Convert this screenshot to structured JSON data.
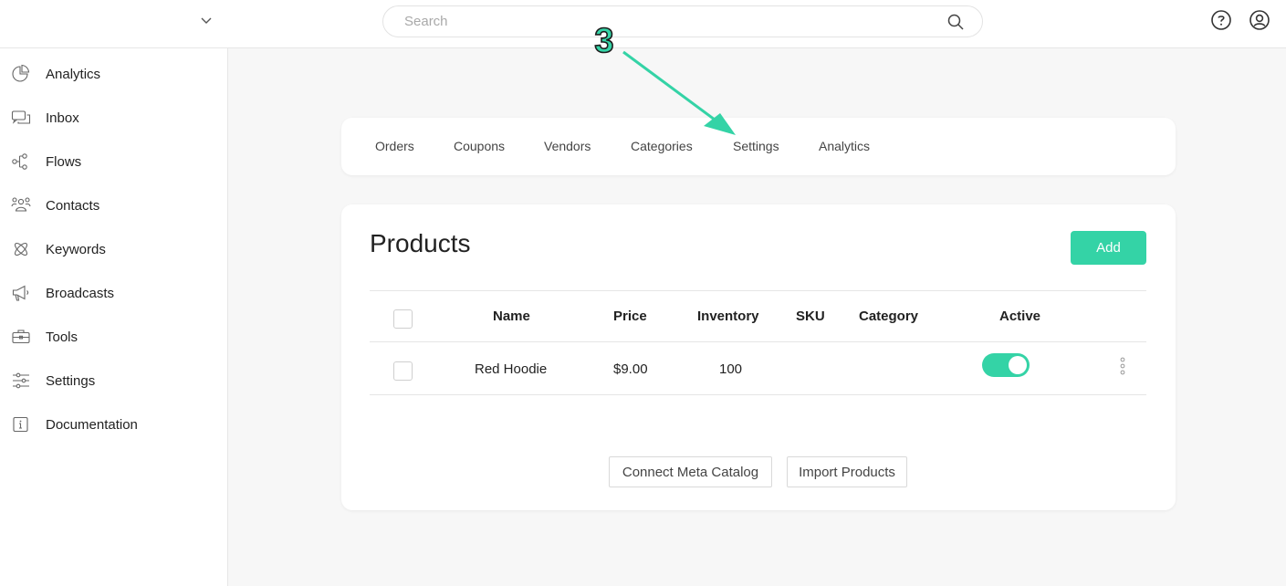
{
  "topbar": {
    "search_placeholder": "Search"
  },
  "sidebar": {
    "items": [
      {
        "label": "Analytics",
        "icon": "analytics-icon"
      },
      {
        "label": "Inbox",
        "icon": "inbox-icon"
      },
      {
        "label": "Flows",
        "icon": "flows-icon"
      },
      {
        "label": "Contacts",
        "icon": "contacts-icon"
      },
      {
        "label": "Keywords",
        "icon": "keywords-icon"
      },
      {
        "label": "Broadcasts",
        "icon": "broadcasts-icon"
      },
      {
        "label": "Tools",
        "icon": "tools-icon"
      },
      {
        "label": "Settings",
        "icon": "settings-icon"
      },
      {
        "label": "Documentation",
        "icon": "documentation-icon"
      }
    ]
  },
  "tabs": [
    "Orders",
    "Coupons",
    "Vendors",
    "Categories",
    "Settings",
    "Analytics"
  ],
  "products": {
    "title": "Products",
    "add_label": "Add",
    "columns": [
      "Name",
      "Price",
      "Inventory",
      "SKU",
      "Category",
      "Active"
    ],
    "rows": [
      {
        "name": "Red Hoodie",
        "price": "$9.00",
        "inventory": "100",
        "sku": "",
        "category": "",
        "active": true
      }
    ],
    "connect_label": "Connect Meta Catalog",
    "import_label": "Import Products"
  },
  "annotation": {
    "step_number": "3",
    "color": "#34d3a6"
  },
  "colors": {
    "accent": "#34d3a6"
  }
}
